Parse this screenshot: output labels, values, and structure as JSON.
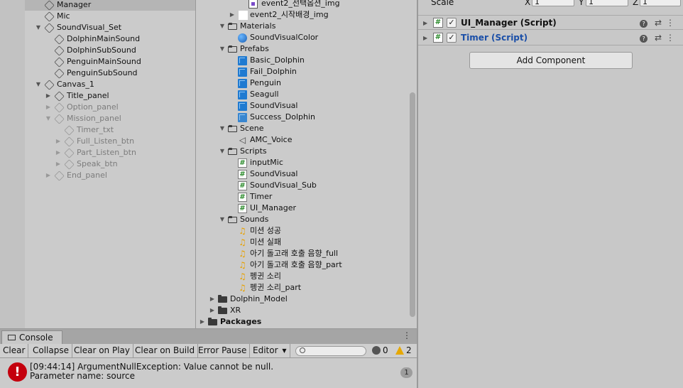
{
  "hierarchy": {
    "items": [
      {
        "label": "Manager",
        "dim": false
      },
      {
        "label": "Mic",
        "dim": false
      },
      {
        "label": "SoundVisual_Set",
        "dim": false
      },
      {
        "label": "DolphinMainSound",
        "dim": false
      },
      {
        "label": "DolphinSubSound",
        "dim": false
      },
      {
        "label": "PenguinMainSound",
        "dim": false
      },
      {
        "label": "PenguinSubSound",
        "dim": false
      },
      {
        "label": "Canvas_1",
        "dim": false
      },
      {
        "label": "Title_panel",
        "dim": false
      },
      {
        "label": "Option_panel",
        "dim": true
      },
      {
        "label": "Mission_panel",
        "dim": true
      },
      {
        "label": "Timer_txt",
        "dim": true
      },
      {
        "label": "Full_Listen_btn",
        "dim": true
      },
      {
        "label": "Part_Listen_btn",
        "dim": true
      },
      {
        "label": "Speak_btn",
        "dim": true
      },
      {
        "label": "End_panel",
        "dim": true
      }
    ]
  },
  "project": {
    "items": [
      {
        "label": "event2_선택옵션_img",
        "icon": "sprite-icon"
      },
      {
        "label": "event2_시작배경_img",
        "icon": "texture-icon"
      },
      {
        "label": "Materials",
        "icon": "folder-open-icon"
      },
      {
        "label": "SoundVisualColor",
        "icon": "material-icon"
      },
      {
        "label": "Prefabs",
        "icon": "folder-open-icon"
      },
      {
        "label": "Basic_Dolphin",
        "icon": "prefab-icon"
      },
      {
        "label": "Fail_Dolphin",
        "icon": "prefab-icon"
      },
      {
        "label": "Penguin",
        "icon": "prefab-icon"
      },
      {
        "label": "Seagull",
        "icon": "prefab-icon"
      },
      {
        "label": "SoundVisual",
        "icon": "prefab-icon"
      },
      {
        "label": "Success_Dolphin",
        "icon": "prefab-variant-icon"
      },
      {
        "label": "Scene",
        "icon": "folder-open-icon"
      },
      {
        "label": "AMC_Voice",
        "icon": "audio-mixer-icon"
      },
      {
        "label": "Scripts",
        "icon": "folder-open-icon"
      },
      {
        "label": "inputMic",
        "icon": "script-icon"
      },
      {
        "label": "SoundVisual",
        "icon": "script-icon"
      },
      {
        "label": "SoundVisual_Sub",
        "icon": "script-icon"
      },
      {
        "label": "Timer",
        "icon": "script-icon"
      },
      {
        "label": "UI_Manager",
        "icon": "script-icon"
      },
      {
        "label": "Sounds",
        "icon": "folder-open-icon"
      },
      {
        "label": "미션 성공",
        "icon": "audio-clip-icon"
      },
      {
        "label": "미션 실패",
        "icon": "audio-clip-icon"
      },
      {
        "label": "아기 돌고래 호출 음향_full",
        "icon": "audio-clip-icon"
      },
      {
        "label": "아기 돌고래 호출 음향_part",
        "icon": "audio-clip-icon"
      },
      {
        "label": "펭귄 소리",
        "icon": "audio-clip-icon"
      },
      {
        "label": "펭귄 소리_part",
        "icon": "audio-clip-icon"
      },
      {
        "label": "Dolphin_Model",
        "icon": "folder-icon"
      },
      {
        "label": "XR",
        "icon": "folder-icon"
      },
      {
        "label": "Packages",
        "icon": "folder-icon"
      }
    ]
  },
  "console": {
    "tab_label": "Console",
    "buttons": {
      "clear": "Clear",
      "collapse": "Collapse",
      "clear_on_play": "Clear on Play",
      "clear_on_build": "Clear on Build",
      "error_pause": "Error Pause",
      "editor": "Editor"
    },
    "error_count": "0",
    "warning_count": "2",
    "log": {
      "line1": "[09:44:14] ArgumentNullException: Value cannot be null.",
      "line2": "Parameter name: source",
      "count": "1"
    }
  },
  "inspector": {
    "scale_label": "Scale",
    "scale": {
      "x_label": "X",
      "x": "1",
      "y_label": "Y",
      "y": "1",
      "z_label": "Z",
      "z": "1"
    },
    "components": [
      {
        "title": "UI_Manager (Script)",
        "checked": true
      },
      {
        "title": "Timer (Script)",
        "checked": true
      }
    ],
    "add_component": "Add Component"
  },
  "colors": {
    "timer_title": "#1b4fa8",
    "error_red": "#c4000d",
    "prefab_blue": "#1f7ad1"
  }
}
